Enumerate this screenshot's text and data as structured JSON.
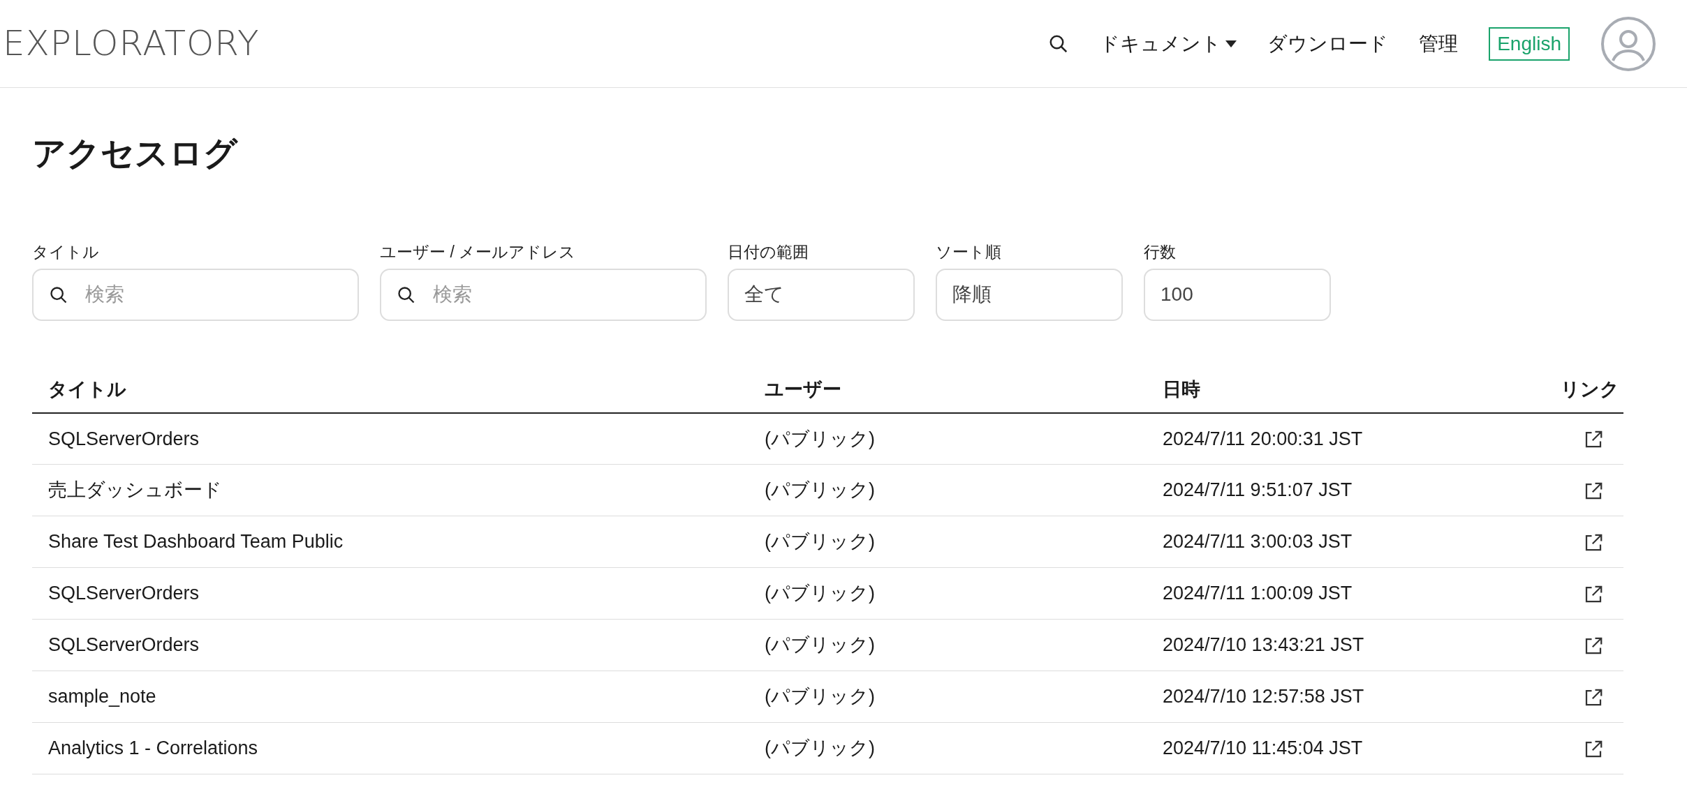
{
  "header": {
    "logo": "EXPLORATORY",
    "nav": [
      {
        "kind": "search"
      },
      {
        "kind": "dropdown",
        "label": "ドキュメント"
      },
      {
        "kind": "link",
        "label": "ダウンロード"
      },
      {
        "kind": "link",
        "label": "管理"
      },
      {
        "kind": "language",
        "label": "English"
      },
      {
        "kind": "avatar"
      }
    ]
  },
  "page_title": "アクセスログ",
  "filters": [
    {
      "label": "タイトル",
      "kind": "search",
      "placeholder": "検索"
    },
    {
      "label": "ユーザー / メールアドレス",
      "kind": "search",
      "placeholder": "検索"
    },
    {
      "label": "日付の範囲",
      "kind": "select",
      "value": "全て"
    },
    {
      "label": "ソート順",
      "kind": "select",
      "value": "降順"
    },
    {
      "label": "行数",
      "kind": "number",
      "value": "100"
    }
  ],
  "table": {
    "columns": [
      "タイトル",
      "ユーザー",
      "日時",
      "リンク"
    ],
    "rows": [
      [
        "SQLServerOrders",
        "(パブリック)",
        "2024/7/11 20:00:31 JST"
      ],
      [
        "売上ダッシュボード",
        "(パブリック)",
        "2024/7/11 9:51:07 JST"
      ],
      [
        "Share Test Dashboard Team Public",
        "(パブリック)",
        "2024/7/11 3:00:03 JST"
      ],
      [
        "SQLServerOrders",
        "(パブリック)",
        "2024/7/11 1:00:09 JST"
      ],
      [
        "SQLServerOrders",
        "(パブリック)",
        "2024/7/10 13:43:21 JST"
      ],
      [
        "sample_note",
        "(パブリック)",
        "2024/7/10 12:57:58 JST"
      ],
      [
        "Analytics 1 - Correlations",
        "(パブリック)",
        "2024/7/10 11:45:04 JST"
      ]
    ]
  }
}
